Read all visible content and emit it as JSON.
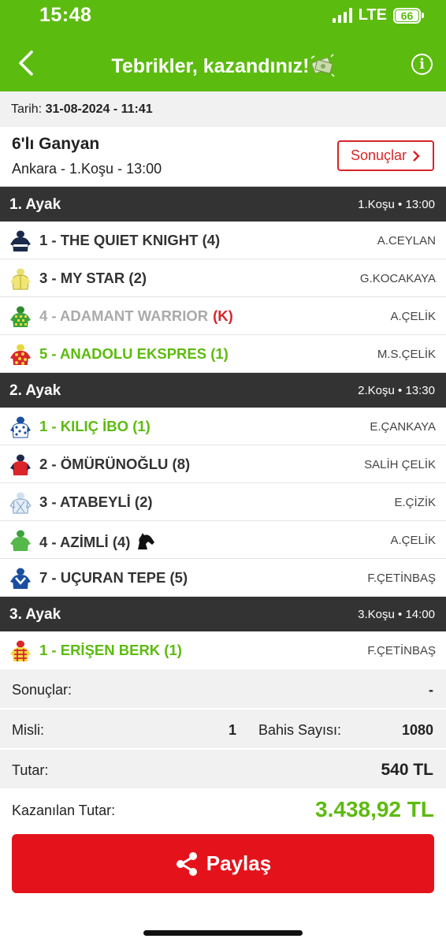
{
  "status_bar": {
    "time": "15:48",
    "network": "LTE",
    "battery": "66"
  },
  "header": {
    "title": "Tebrikler, kazandınız!",
    "icon_back": "chevron-left-icon",
    "icon_info": "info-icon",
    "info_glyph": "i"
  },
  "ticket": {
    "date_label": "Tarih:",
    "date_value": "31-08-2024 - 11:41",
    "bet_type": "6'lı Ganyan",
    "race_info": "Ankara - 1.Koşu - 13:00",
    "results_button": "Sonuçlar"
  },
  "legs": [
    {
      "title": "1. Ayak",
      "race": "1.Koşu • 13:00",
      "horses": [
        {
          "name": "1 - THE QUIET KNIGHT (4)",
          "jockey": "A.CEYLAN",
          "status": "normal",
          "flag": ""
        },
        {
          "name": "3 - MY STAR (2)",
          "jockey": "G.KOCAKAYA",
          "status": "normal",
          "flag": ""
        },
        {
          "name": "4 - ADAMANT WARRIOR",
          "jockey": "A.ÇELİK",
          "status": "scratched",
          "flag": "(K)"
        },
        {
          "name": "5 - ANADOLU EKSPRES (1)",
          "jockey": "M.S.ÇELİK",
          "status": "winner",
          "flag": ""
        }
      ]
    },
    {
      "title": "2. Ayak",
      "race": "2.Koşu • 13:30",
      "horses": [
        {
          "name": "1 - KILIÇ İBO (1)",
          "jockey": "E.ÇANKAYA",
          "status": "winner",
          "flag": ""
        },
        {
          "name": "2 - ÖMÜRÜNOĞLU (8)",
          "jockey": "SALİH ÇELİK",
          "status": "normal",
          "flag": ""
        },
        {
          "name": "3 - ATABEYLİ (2)",
          "jockey": "E.ÇİZİK",
          "status": "normal",
          "flag": ""
        },
        {
          "name": "4 - AZİMLİ (4)",
          "jockey": "A.ÇELİK",
          "status": "normal",
          "flag": ""
        },
        {
          "name": "7 - UÇURAN TEPE (5)",
          "jockey": "F.ÇETİNBAŞ",
          "status": "normal",
          "flag": ""
        }
      ]
    },
    {
      "title": "3. Ayak",
      "race": "3.Koşu • 14:00",
      "horses": [
        {
          "name": "1 - ERİŞEN BERK (1)",
          "jockey": "F.ÇETİNBAŞ",
          "status": "winner",
          "flag": ""
        }
      ]
    }
  ],
  "summary": {
    "results_label": "Sonuçlar:",
    "results_value": "-",
    "multiplier_label": "Misli:",
    "multiplier_value": "1",
    "bet_count_label": "Bahis Sayısı:",
    "bet_count_value": "1080",
    "amount_label": "Tutar:",
    "amount_value": "540 TL",
    "won_label": "Kazanılan Tutar:",
    "won_value": "3.438,92 TL"
  },
  "share_button": {
    "label": "Paylaş",
    "icon": "share-icon"
  },
  "colors": {
    "brand_green": "#5cbb0f",
    "accent_red": "#e4131b",
    "leg_header": "#333333"
  }
}
